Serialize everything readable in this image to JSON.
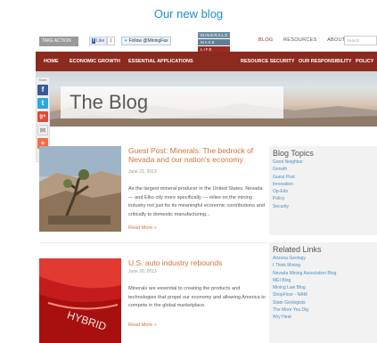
{
  "caption": "Our new blog",
  "topbar": {
    "take_action": "TAKE ACTION",
    "fb_like": "Like",
    "fb_count": "1",
    "twitter_follow": "Follow @MiningFax",
    "logo_lines": [
      "MINERALS",
      "MAKE",
      "LIFE"
    ],
    "nav": [
      "BLOG",
      "RESOURCES",
      "ABOUT"
    ],
    "search_placeholder": "Search"
  },
  "mainnav": [
    "HOME",
    "ECONOMIC GROWTH",
    "ESSENTIAL APPLICATIONS",
    "RESOURCE SECURITY",
    "OUR RESPONSIBILITY",
    "POLICY"
  ],
  "hero": {
    "title": "The Blog"
  },
  "share": {
    "label": "Share",
    "icons": [
      "f",
      "t",
      "g+",
      "✉",
      "+"
    ]
  },
  "posts": [
    {
      "title": "Guest Post: Minerals: The bedrock of Nevada and our nation's economy",
      "date": "June 21, 2013",
      "body": "As the largest mineral producer in the United States, Nevada — and Elko city more specifically — relies on the mining industry not just for its meaningful economic contributions and critically to domestic manufacturing...",
      "more": "Read More »"
    },
    {
      "title": "U.S. auto industry rebounds",
      "date": "June 20, 2013",
      "body": "Minerals are essential to creating the products and technologies that propel our economy and allowing America to compete in the global marketplace.",
      "more": "Read More »"
    }
  ],
  "sidebar": {
    "topics_title": "Blog Topics",
    "topics": [
      "Good Neighbor",
      "Growth",
      "Guest Post",
      "Innovation",
      "Op-Eds",
      "Policy",
      "Security"
    ],
    "links_title": "Related Links",
    "links": [
      "Arizona Geology",
      "I Think Mining",
      "Nevada Mining Association Blog",
      "MEI Blog",
      "Mining Law Blog",
      "ShopFloor - NAM",
      "State Geologists",
      "The More You Dig",
      "Wry Heat"
    ]
  },
  "colors": {
    "brand_red": "#8c2a20",
    "accent_orange": "#d4713a",
    "link_blue": "#4a90c6"
  }
}
